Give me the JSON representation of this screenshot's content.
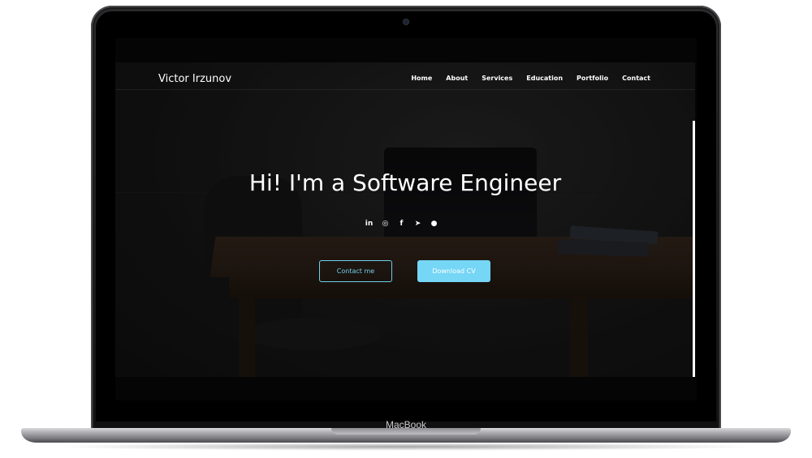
{
  "device": {
    "brand_label": "MacBook"
  },
  "site": {
    "logo": "Victor Irzunov",
    "nav": [
      {
        "label": "Home"
      },
      {
        "label": "About"
      },
      {
        "label": "Services"
      },
      {
        "label": "Education"
      },
      {
        "label": "Portfolio"
      },
      {
        "label": "Contact"
      }
    ],
    "hero": {
      "title": "Hi! I'm a Software Engineer",
      "socials": [
        {
          "icon": "linkedin-icon",
          "glyph": "in"
        },
        {
          "icon": "instagram-icon",
          "glyph": "◎"
        },
        {
          "icon": "facebook-icon",
          "glyph": "f"
        },
        {
          "icon": "telegram-icon",
          "glyph": "➤"
        },
        {
          "icon": "github-icon",
          "glyph": "●"
        }
      ],
      "contact_button": "Contact me",
      "cv_button": "Download CV"
    },
    "colors": {
      "accent": "#75d6f6",
      "accent_outline": "#6fd0ea",
      "text": "#ffffff"
    }
  }
}
